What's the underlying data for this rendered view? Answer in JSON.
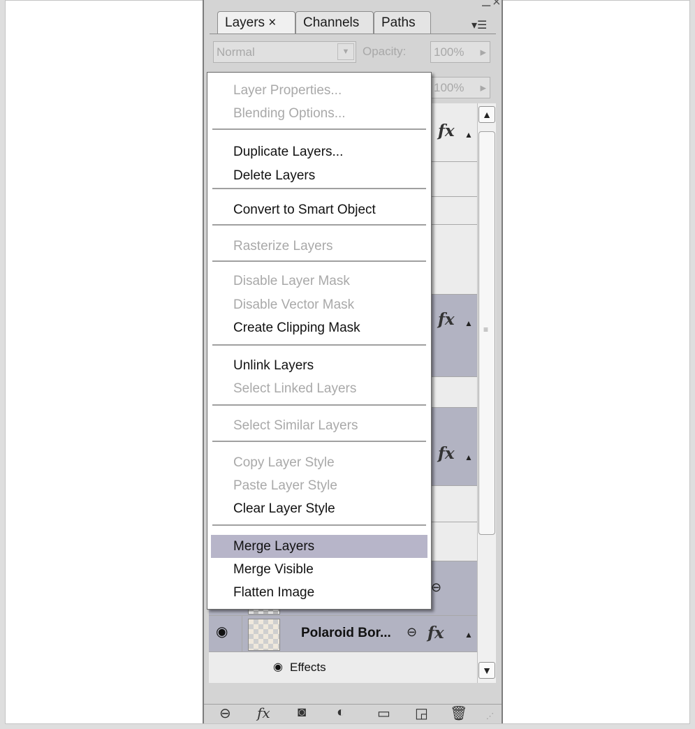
{
  "tabs": [
    "Layers ×",
    "Channels",
    "Paths"
  ],
  "panel_controls": {
    "minimize": "–",
    "close": "×",
    "menu_glyph": "▾☰"
  },
  "blend_mode": "Normal",
  "opacity_label": "Opacity:",
  "opacity_value": "100%",
  "fill_value": "100%",
  "context_menu": {
    "groups": [
      [
        {
          "label": "Layer Properties...",
          "enabled": false
        },
        {
          "label": "Blending Options...",
          "enabled": false
        }
      ],
      [
        {
          "label": "Duplicate Layers...",
          "enabled": true
        },
        {
          "label": "Delete Layers",
          "enabled": true
        }
      ],
      [
        {
          "label": "Convert to Smart Object",
          "enabled": true
        }
      ],
      [
        {
          "label": "Rasterize Layers",
          "enabled": false
        }
      ],
      [
        {
          "label": "Disable Layer Mask",
          "enabled": false
        },
        {
          "label": "Disable Vector Mask",
          "enabled": false
        },
        {
          "label": "Create Clipping Mask",
          "enabled": true
        }
      ],
      [
        {
          "label": "Unlink Layers",
          "enabled": true
        },
        {
          "label": "Select Linked Layers",
          "enabled": false
        }
      ],
      [
        {
          "label": "Select Similar Layers",
          "enabled": false
        }
      ],
      [
        {
          "label": "Copy Layer Style",
          "enabled": false
        },
        {
          "label": "Paste Layer Style",
          "enabled": false
        },
        {
          "label": "Clear Layer Style",
          "enabled": true
        }
      ],
      [
        {
          "label": "Merge Layers",
          "enabled": true,
          "highlighted": true
        },
        {
          "label": "Merge Visible",
          "enabled": true
        },
        {
          "label": "Flatten Image",
          "enabled": true
        }
      ]
    ]
  },
  "layers": {
    "fx_glyph": "fx",
    "visible_layer": {
      "name": "Polaroid Bor...",
      "effects_label": "Effects"
    }
  },
  "bottom_toolbar": [
    "link-layers",
    "add-style",
    "add-mask",
    "adjustment-layer",
    "new-group",
    "new-layer",
    "delete-layer"
  ],
  "colors": {
    "highlight": "#b7b5c9",
    "selected_row": "#b2b3c2",
    "disabled_text": "#a9a9a9"
  }
}
